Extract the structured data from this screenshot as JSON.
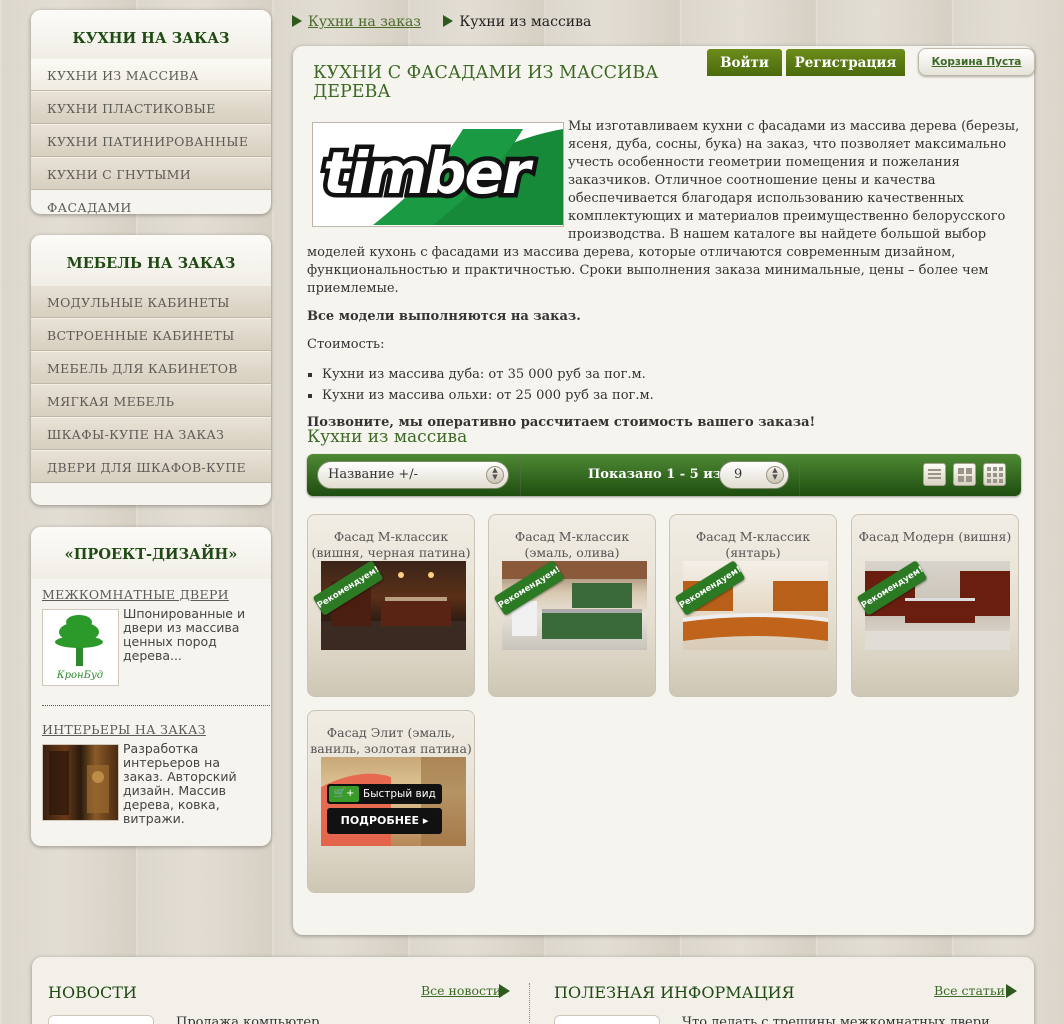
{
  "sidebar": {
    "box1": {
      "title": "КУХНИ НА ЗАКАЗ",
      "items": [
        "КУХНИ ИЗ МАССИВА",
        "КУХНИ ПЛАСТИКОВЫЕ",
        "КУХНИ ПАТИНИРОВАННЫЕ",
        "КУХНИ С ГНУТЫМИ ФАСАДАМИ"
      ]
    },
    "box2": {
      "title": "МЕБЕЛЬ НА ЗАКАЗ",
      "items": [
        "МОДУЛЬНЫЕ КАБИНЕТЫ",
        "ВСТРОЕННЫЕ КАБИНЕТЫ",
        "МЕБЕЛЬ ДЛЯ КАБИНЕТОВ",
        "МЯГКАЯ МЕБЕЛЬ",
        "ШКАФЫ-КУПЕ НА ЗАКАЗ",
        "ДВЕРИ ДЛЯ ШКАФОВ-КУПЕ"
      ]
    },
    "box3": {
      "title": "«ПРОЕКТ-ДИЗАЙН»",
      "promos": [
        {
          "heading": "МЕЖКОМНАТНЫЕ ДВЕРИ",
          "text": "Шпонированные и двери из массива ценных пород дерева...",
          "logo_text": "КронБуд"
        },
        {
          "heading": "ИНТЕРЬЕРЫ НА ЗАКАЗ",
          "text": "Разработка интерьеров на заказ. Авторский дизайн. Массив дерева, ковка, витражи."
        }
      ]
    }
  },
  "breadcrumb": {
    "parent": "Кухни на заказ",
    "current": "Кухни из массива"
  },
  "header": {
    "login": "Войти",
    "register": "Регистрация",
    "cart": "Корзина Пуста"
  },
  "main": {
    "title": "КУХНИ С ФАСАДАМИ ИЗ МАССИВА ДЕРЕВА",
    "logo_text": "timber",
    "intro": "Мы изготавливаем кухни с фасадами из массива дерева (березы, ясеня, дуба, сосны, бука) на заказ, что позволяет максимально учесть особенности геометрии помещения и пожелания заказчиков. Отличное соотношение цены и качества обеспечивается благодаря использованию качественных комплектующих и материалов преимущественно белорусского производства. В нашем каталоге вы найдете большой выбор моделей кухонь с фасадами из массива дерева, которые отличаются современным дизайном, функциональностью и практичностью. Сроки выполнения заказа минимальные, цены – более чем приемлемые.",
    "bold_note": "Все модели выполняются на заказ.",
    "cost_label": "Стоимость:",
    "prices": [
      "Кухни из массива дуба: от 35 000 руб за пог.м.",
      "Кухни из массива ольхи: от 25 000 руб за пог.м."
    ],
    "call": "Позвоните, мы оперативно рассчитаем стоимость вашего заказа!",
    "section_title": "Кухни из массива"
  },
  "toolbar": {
    "sort": "Название +/-",
    "shown": "Показано 1 - 5 из 5",
    "per_page": "9"
  },
  "products": [
    {
      "title": "Фасад М-классик (вишня, черная патина)",
      "badge": "Рекомендуем!"
    },
    {
      "title": "Фасад М-классик (эмаль, олива)",
      "badge": "Рекомендуем!"
    },
    {
      "title": "Фасад М-классик (янтарь)",
      "badge": "Рекомендуем!"
    },
    {
      "title": "Фасад Модерн (вишня)",
      "badge": "Рекомендуем!"
    },
    {
      "title": "Фасад Элит (эмаль, ваниль, золотая патина)",
      "quick_view": "Быстрый вид",
      "more": "ПОДРОБНЕЕ"
    }
  ],
  "footer": {
    "news_title": "НОВОСТИ",
    "news_link": "Все новости",
    "news_text": "Продажа компьютер...",
    "info_title": "ПОЛЕЗНАЯ ИНФОРМАЦИЯ",
    "info_link": "Все статьи",
    "info_text": "Что делать с трещины межкомнатных двери..."
  },
  "colors": {
    "accent_green": "#3c6a26",
    "button_green": "#5c7c12",
    "toolbar_green": "#2f6a20",
    "ribbon": "#2d7a25"
  }
}
